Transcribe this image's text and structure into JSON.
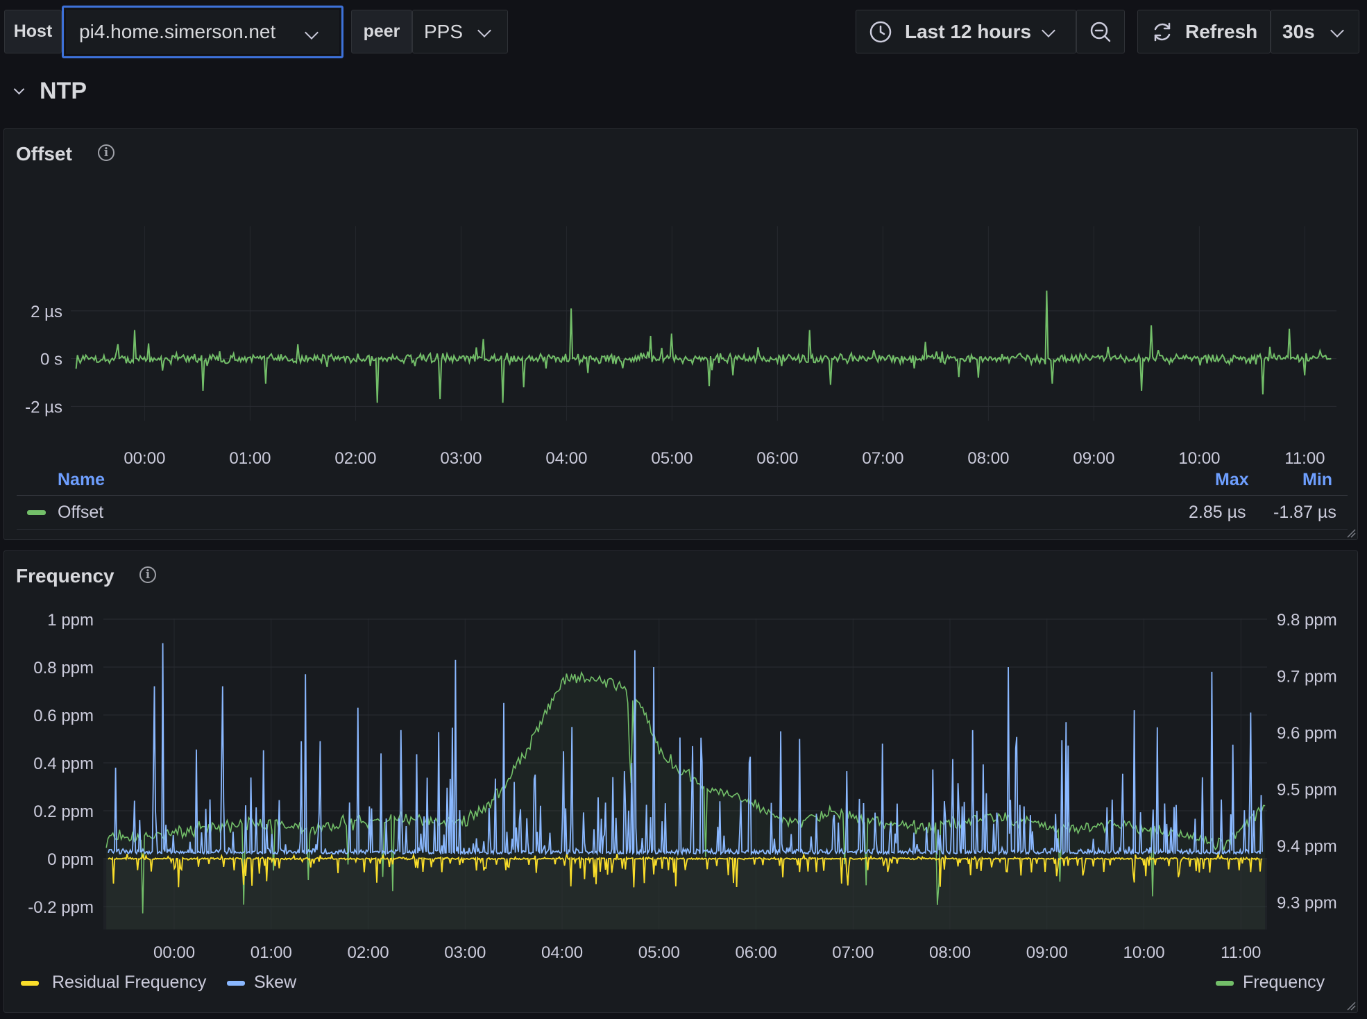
{
  "toolbar": {
    "host_label": "Host",
    "host_value": "pi4.home.simerson.net",
    "peer_label": "peer",
    "peer_value": "PPS",
    "time_range": "Last 12 hours",
    "refresh_label": "Refresh",
    "refresh_interval": "30s"
  },
  "row": {
    "title": "NTP"
  },
  "colors": {
    "offset": "#73bf69",
    "residual": "#fade2a",
    "skew": "#8ab8ff",
    "frequency": "#73bf69",
    "accent": "#3d71d9"
  },
  "offset_panel": {
    "title": "Offset",
    "legend": {
      "name_header": "Name",
      "max_header": "Max",
      "min_header": "Min",
      "series_name": "Offset",
      "max": "2.85 µs",
      "min": "-1.87 µs"
    }
  },
  "frequency_panel": {
    "title": "Frequency",
    "legend": {
      "residual": "Residual Frequency",
      "skew": "Skew",
      "frequency": "Frequency"
    }
  },
  "chart_data": [
    {
      "type": "line",
      "title": "Offset",
      "x_ticks": [
        "00:00",
        "01:00",
        "02:00",
        "03:00",
        "04:00",
        "05:00",
        "06:00",
        "07:00",
        "08:00",
        "09:00",
        "10:00",
        "11:00"
      ],
      "y_ticks": [
        "2 µs",
        "0 s",
        "-2 µs"
      ],
      "ylim_us": [
        -2.6,
        3.8
      ],
      "x_range_hours": [
        -0.7,
        11.3
      ],
      "grid": true,
      "series": [
        {
          "name": "Offset",
          "color": "#73bf69",
          "max_us": 2.85,
          "min_us": -1.87,
          "spikes": [
            [
              -0.1,
              1.2
            ],
            [
              0.55,
              -1.35
            ],
            [
              1.15,
              -1.05
            ],
            [
              1.45,
              0.6
            ],
            [
              2.2,
              -1.85
            ],
            [
              2.8,
              -1.7
            ],
            [
              3.4,
              -1.85
            ],
            [
              3.6,
              -1.2
            ],
            [
              4.05,
              2.1
            ],
            [
              4.2,
              -0.6
            ],
            [
              4.8,
              0.95
            ],
            [
              5.0,
              1.05
            ],
            [
              5.35,
              -1.15
            ],
            [
              6.3,
              1.2
            ],
            [
              6.5,
              -1.1
            ],
            [
              7.4,
              0.7
            ],
            [
              7.9,
              -0.8
            ],
            [
              8.55,
              2.85
            ],
            [
              8.6,
              -1.05
            ],
            [
              9.45,
              -1.35
            ],
            [
              9.55,
              1.4
            ],
            [
              10.6,
              -1.5
            ],
            [
              10.85,
              1.25
            ],
            [
              11.0,
              -0.7
            ]
          ]
        }
      ]
    },
    {
      "type": "line",
      "title": "Frequency",
      "x_ticks": [
        "00:00",
        "01:00",
        "02:00",
        "03:00",
        "04:00",
        "05:00",
        "06:00",
        "07:00",
        "08:00",
        "09:00",
        "10:00",
        "11:00"
      ],
      "y_left_ticks": [
        "1 ppm",
        "0.8 ppm",
        "0.6 ppm",
        "0.4 ppm",
        "0.2 ppm",
        "0 ppm",
        "-0.2 ppm"
      ],
      "y_right_ticks": [
        "9.8 ppm",
        "9.7 ppm",
        "9.6 ppm",
        "9.5 ppm",
        "9.4 ppm",
        "9.3 ppm"
      ],
      "ylim_left_ppm": [
        -0.3,
        1.0
      ],
      "ylim_right_ppm": [
        9.25,
        9.8
      ],
      "x_range_hours": [
        -0.73,
        11.27
      ],
      "grid": true,
      "series": [
        {
          "name": "Residual Frequency",
          "axis": "left",
          "color": "#fade2a",
          "baseline_ppm": 0,
          "min_ppm": -0.12
        },
        {
          "name": "Skew",
          "axis": "left",
          "color": "#8ab8ff",
          "baseline_ppm": 0.02,
          "peaks": [
            [
              -0.6,
              0.38
            ],
            [
              -0.2,
              0.72
            ],
            [
              -0.12,
              0.9
            ],
            [
              0.5,
              0.72
            ],
            [
              1.35,
              0.77
            ],
            [
              1.9,
              0.63
            ],
            [
              2.9,
              0.83
            ],
            [
              3.4,
              0.65
            ],
            [
              4.1,
              0.55
            ],
            [
              4.75,
              0.87
            ],
            [
              4.95,
              0.8
            ],
            [
              5.35,
              0.47
            ],
            [
              6.45,
              0.5
            ],
            [
              7.3,
              0.48
            ],
            [
              8.6,
              0.8
            ],
            [
              9.2,
              0.57
            ],
            [
              9.9,
              0.62
            ],
            [
              10.7,
              0.78
            ],
            [
              11.1,
              0.61
            ]
          ]
        },
        {
          "name": "Frequency",
          "axis": "right",
          "color": "#73bf69",
          "x_hours": [
            -0.7,
            -0.2,
            0.3,
            0.8,
            1.3,
            1.8,
            2.3,
            2.8,
            3.1,
            3.4,
            3.6,
            3.8,
            4.0,
            4.2,
            4.4,
            4.6,
            4.8,
            5.0,
            5.2,
            5.5,
            5.9,
            6.3,
            6.8,
            7.3,
            7.8,
            8.3,
            8.8,
            9.3,
            9.8,
            10.3,
            10.8,
            11.25
          ],
          "y_ppm": [
            9.41,
            9.42,
            9.43,
            9.44,
            9.43,
            9.44,
            9.45,
            9.44,
            9.45,
            9.5,
            9.56,
            9.62,
            9.69,
            9.7,
            9.69,
            9.68,
            9.65,
            9.57,
            9.53,
            9.5,
            9.48,
            9.44,
            9.46,
            9.44,
            9.43,
            9.45,
            9.44,
            9.43,
            9.44,
            9.42,
            9.4,
            9.47
          ]
        }
      ]
    }
  ]
}
